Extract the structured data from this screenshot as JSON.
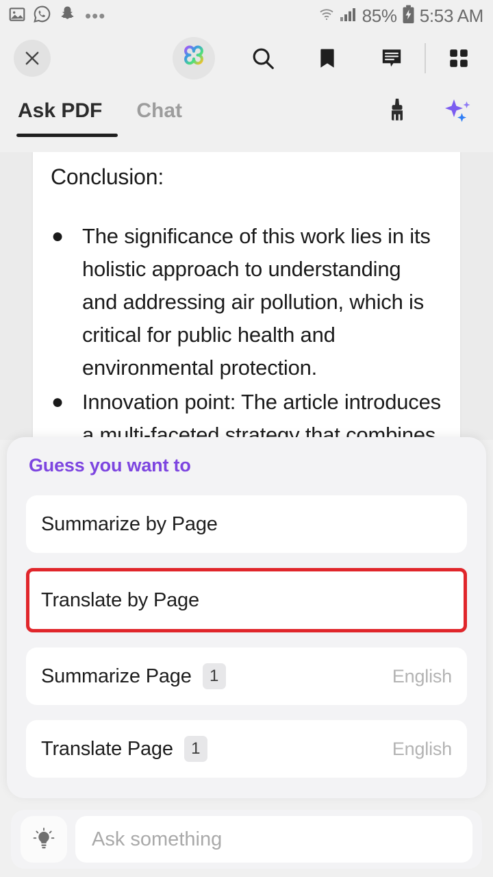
{
  "status_bar": {
    "left_icons": [
      "gallery-icon",
      "whatsapp-icon",
      "snapchat-icon"
    ],
    "overflow": "•••",
    "battery_percent": "85%",
    "time": "5:53 AM"
  },
  "toolbar": {
    "close_label": "×",
    "icons": [
      "close-icon",
      "ai-clover-icon",
      "search-icon",
      "bookmark-icon",
      "comment-icon",
      "grid-icon"
    ]
  },
  "tabs": {
    "items": [
      {
        "label": "Ask PDF",
        "active": true
      },
      {
        "label": "Chat",
        "active": false
      }
    ],
    "actions": [
      "brush-icon",
      "sparkles-icon"
    ]
  },
  "document": {
    "heading": "Conclusion:",
    "bullets": [
      "The significance of this work lies in its holistic approach to understanding and addressing air pollution, which is critical for public health and environmental protection.",
      "Innovation point: The article introduces a multi-faceted strategy that combines scientific research with policy-making and community"
    ],
    "bullet_glyph": "●"
  },
  "suggestions": {
    "title": "Guess you want to",
    "title_color": "#7d45e0",
    "highlight_color": "#e0262b",
    "items": [
      {
        "label": "Summarize by Page",
        "badge": "",
        "lang": "",
        "highlighted": false
      },
      {
        "label": "Translate by Page",
        "badge": "",
        "lang": "",
        "highlighted": true
      },
      {
        "label": "Summarize Page",
        "badge": "1",
        "lang": "English",
        "highlighted": false
      },
      {
        "label": "Translate Page",
        "badge": "1",
        "lang": "English",
        "highlighted": false
      }
    ]
  },
  "input_bar": {
    "bulb_icon": "lightbulb-icon",
    "placeholder": "Ask something",
    "value": ""
  }
}
